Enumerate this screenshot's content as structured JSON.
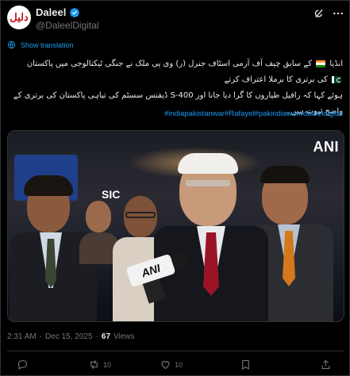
{
  "author": {
    "display_name": "Daleel",
    "handle": "@DaleelDigital",
    "avatar_text": "دلیل",
    "verified_icon": "verified-badge-icon"
  },
  "header_icons": [
    "grok-icon",
    "more-icon"
  ],
  "show_translation_label": "Show translation",
  "body": {
    "line1_part1": "انڈیا",
    "line1_part2": "کے سابق چیف آف آرمی اسٹاف جنرل (ر) وی پی ملک نے جنگی ٹیکنالوجی میں پاکستان",
    "line1_part3": "کی برتری کا برملا اعتراف کرتے",
    "line2": "ہوئے کہا کہ رافیل طیاروں کا گرا دیا جانا اور S-400 ڈیفنس سسٹم کی تباہی پاکستان کی برتری کے واضح ثبوت ہیں۔",
    "hashtags": "#indiapakistanwar#Rafayel#pakindiawar#daleeldigital"
  },
  "media": {
    "watermark": "ANI",
    "mic_label": "ANI",
    "screen_text": "SIC"
  },
  "meta": {
    "time": "2:31 AM",
    "separator": "·",
    "date": "Dec 15, 2025",
    "separator2": "·",
    "views_count": "67",
    "views_label": "Views"
  },
  "actions": {
    "reply_count": "",
    "retweet_count": "10",
    "like_count": "10",
    "bookmark_count": ""
  },
  "colors": {
    "background": "#000000",
    "link": "#1d9bf0",
    "muted": "#71767b",
    "verified": "#1d9bf0"
  }
}
